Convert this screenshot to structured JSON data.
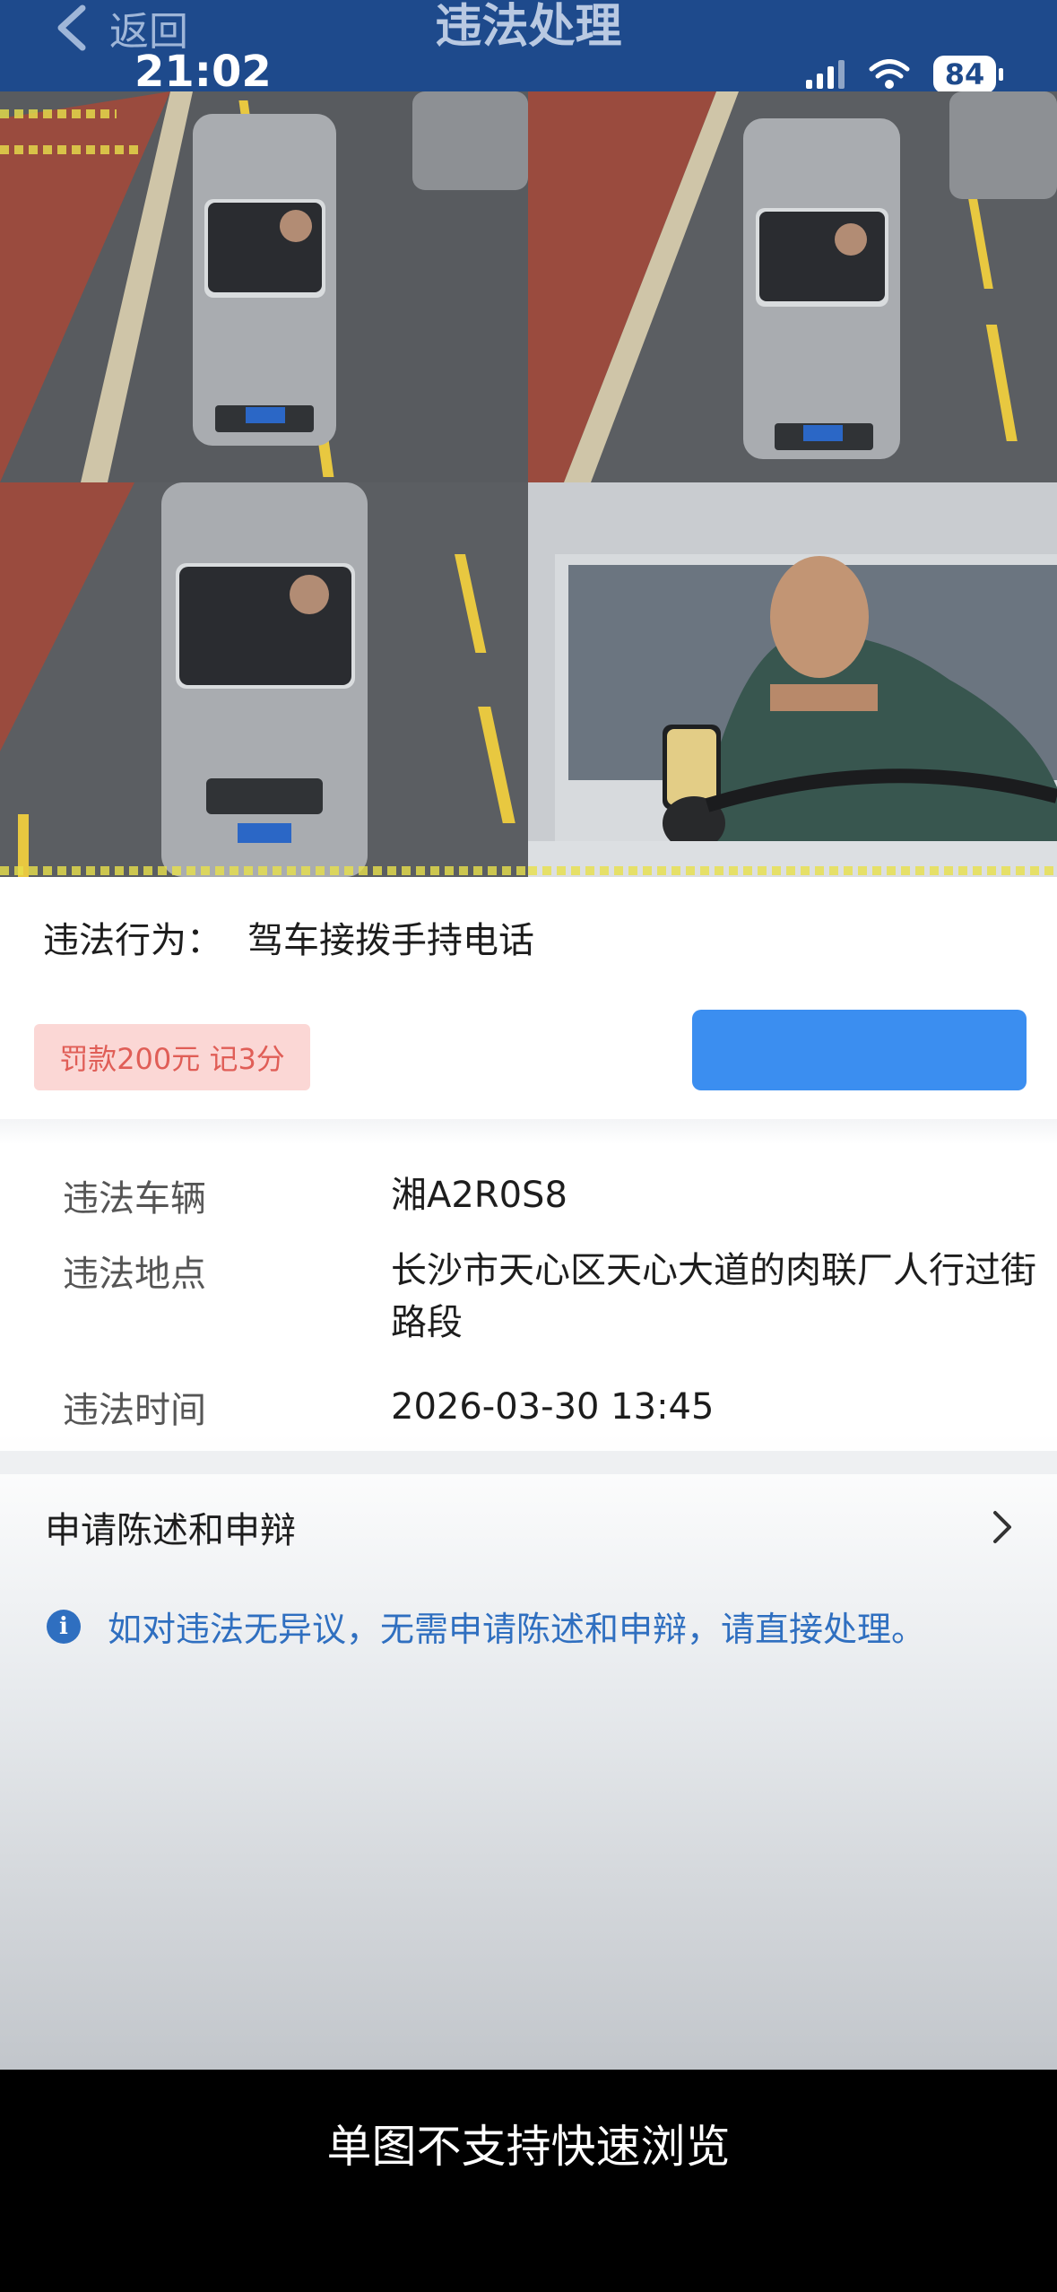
{
  "header": {
    "back_label": "返回",
    "title": "违法处理"
  },
  "status_bar": {
    "time": "21:02",
    "battery": "84"
  },
  "violation": {
    "behavior_label": "违法行为：",
    "behavior_value": "驾车接拨手持电话",
    "fine_badge": "罚款200元 记3分",
    "action_button_label": ""
  },
  "details": {
    "vehicle_label": "违法车辆",
    "vehicle_value": "湘A2R0S8",
    "location_label": "违法地点",
    "location_value": "长沙市天心区天心大道的肉联厂人行过街路段",
    "time_label": "违法时间",
    "time_value": "2026-03-30 13:45"
  },
  "appeal": {
    "label": "申请陈述和申辩",
    "notice": "如对违法无异议，无需申请陈述和申辩，请直接处理。"
  },
  "bottom_bar": {
    "text": "单图不支持快速浏览"
  },
  "colors": {
    "header_bg": "#1e4a8c",
    "accent_blue": "#3b8ef0",
    "fine_bg": "#fbd7d5",
    "fine_text": "#e05e57",
    "notice_text": "#2f6fc0"
  },
  "photos": [
    "camera-photo-1",
    "camera-photo-2",
    "camera-photo-3",
    "driver-closeup-photo"
  ]
}
